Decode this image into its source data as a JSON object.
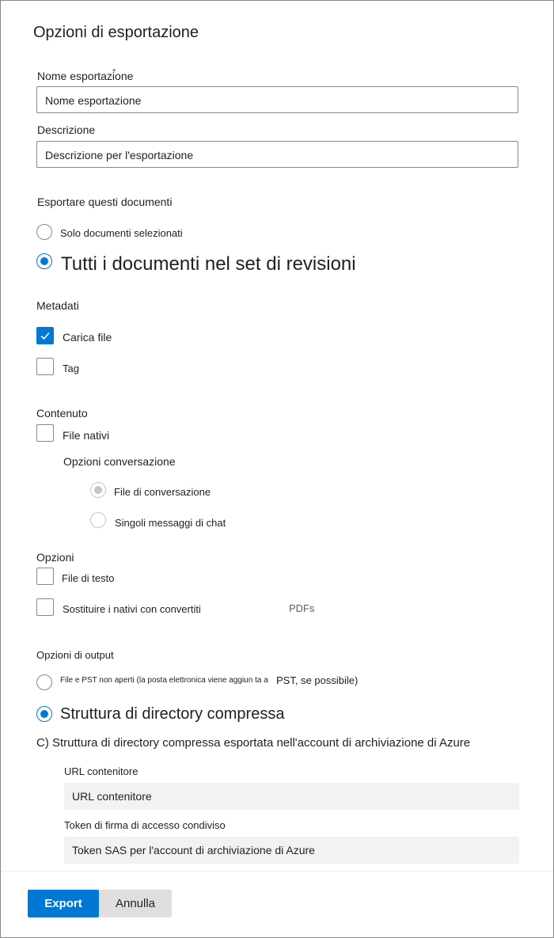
{
  "dialog": {
    "title": "Opzioni di esportazione"
  },
  "export_name": {
    "label": "Nome esportazione",
    "required_marker": "*",
    "value": "Nome esportazione"
  },
  "description": {
    "label": "Descrizione",
    "value": "Descrizione per l'esportazione"
  },
  "export_docs": {
    "heading": "Esportare questi documenti",
    "option_selected_only": "Solo documenti selezionati",
    "option_all": "Tutti i documenti nel set di revisioni"
  },
  "metadata": {
    "heading": "Metadati",
    "load_file": "Carica file",
    "tags": "Tag"
  },
  "content": {
    "heading": "Contenuto",
    "native_files": "File nativi",
    "conversation_options_heading": "Opzioni conversazione",
    "conversation_files": "File di conversazione",
    "single_chat_messages": "Singoli messaggi di chat"
  },
  "options": {
    "heading": "Opzioni",
    "text_files": "File di testo",
    "replace_natives": "Sostituire i nativi con convertiti",
    "pdfs": "PDFs"
  },
  "output_options": {
    "heading": "Opzioni di output",
    "opt1_small": "File e PST non aperti (la posta elettronica viene aggiun ta a",
    "opt1_large": "PST, se possibile)",
    "opt2": "Struttura di directory compressa",
    "opt3": "C) Struttura di directory compressa esportata nell'account di archiviazione di Azure"
  },
  "container_url": {
    "label": "URL contenitore",
    "placeholder": "URL contenitore"
  },
  "sas_token": {
    "label": "Token di firma di accesso condiviso",
    "placeholder": "Token SAS per l'account di archiviazione di Azure"
  },
  "footer": {
    "export_label": "Export",
    "cancel_label": "Annulla"
  },
  "colors": {
    "accent": "#0078d4",
    "border": "#8a8886",
    "field_bg": "#f3f2f1"
  }
}
